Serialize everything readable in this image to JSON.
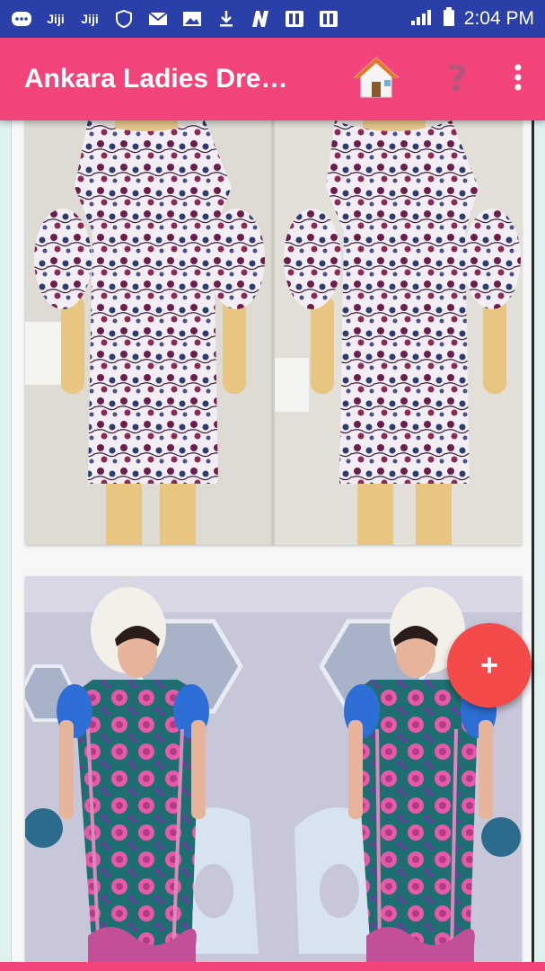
{
  "status_bar": {
    "time": "2:04 PM",
    "notification_icons": [
      "message-icon",
      "jiji-icon",
      "jiji-icon",
      "shield-icon",
      "mail-icon",
      "image-icon",
      "download-icon",
      "n-icon",
      "pdf-icon",
      "pdf-icon"
    ],
    "jiji_label": "Jiji"
  },
  "app_bar": {
    "title": "Ankara Ladies Dre…",
    "actions": [
      "home-icon",
      "help-icon",
      "overflow-menu-icon"
    ],
    "help_glyph": "?"
  },
  "feed": {
    "items": [
      {
        "description_icon": "dress-photo",
        "pattern": "white-purple-floral"
      },
      {
        "description_icon": "dress-photo",
        "pattern": "teal-pink-floral"
      }
    ]
  },
  "fab": {
    "glyph": "+"
  },
  "colors": {
    "status_bar": "#2b3fa8",
    "app_bar": "#f2437a",
    "fab": "#f44a4a",
    "background": "#dff1ee"
  }
}
